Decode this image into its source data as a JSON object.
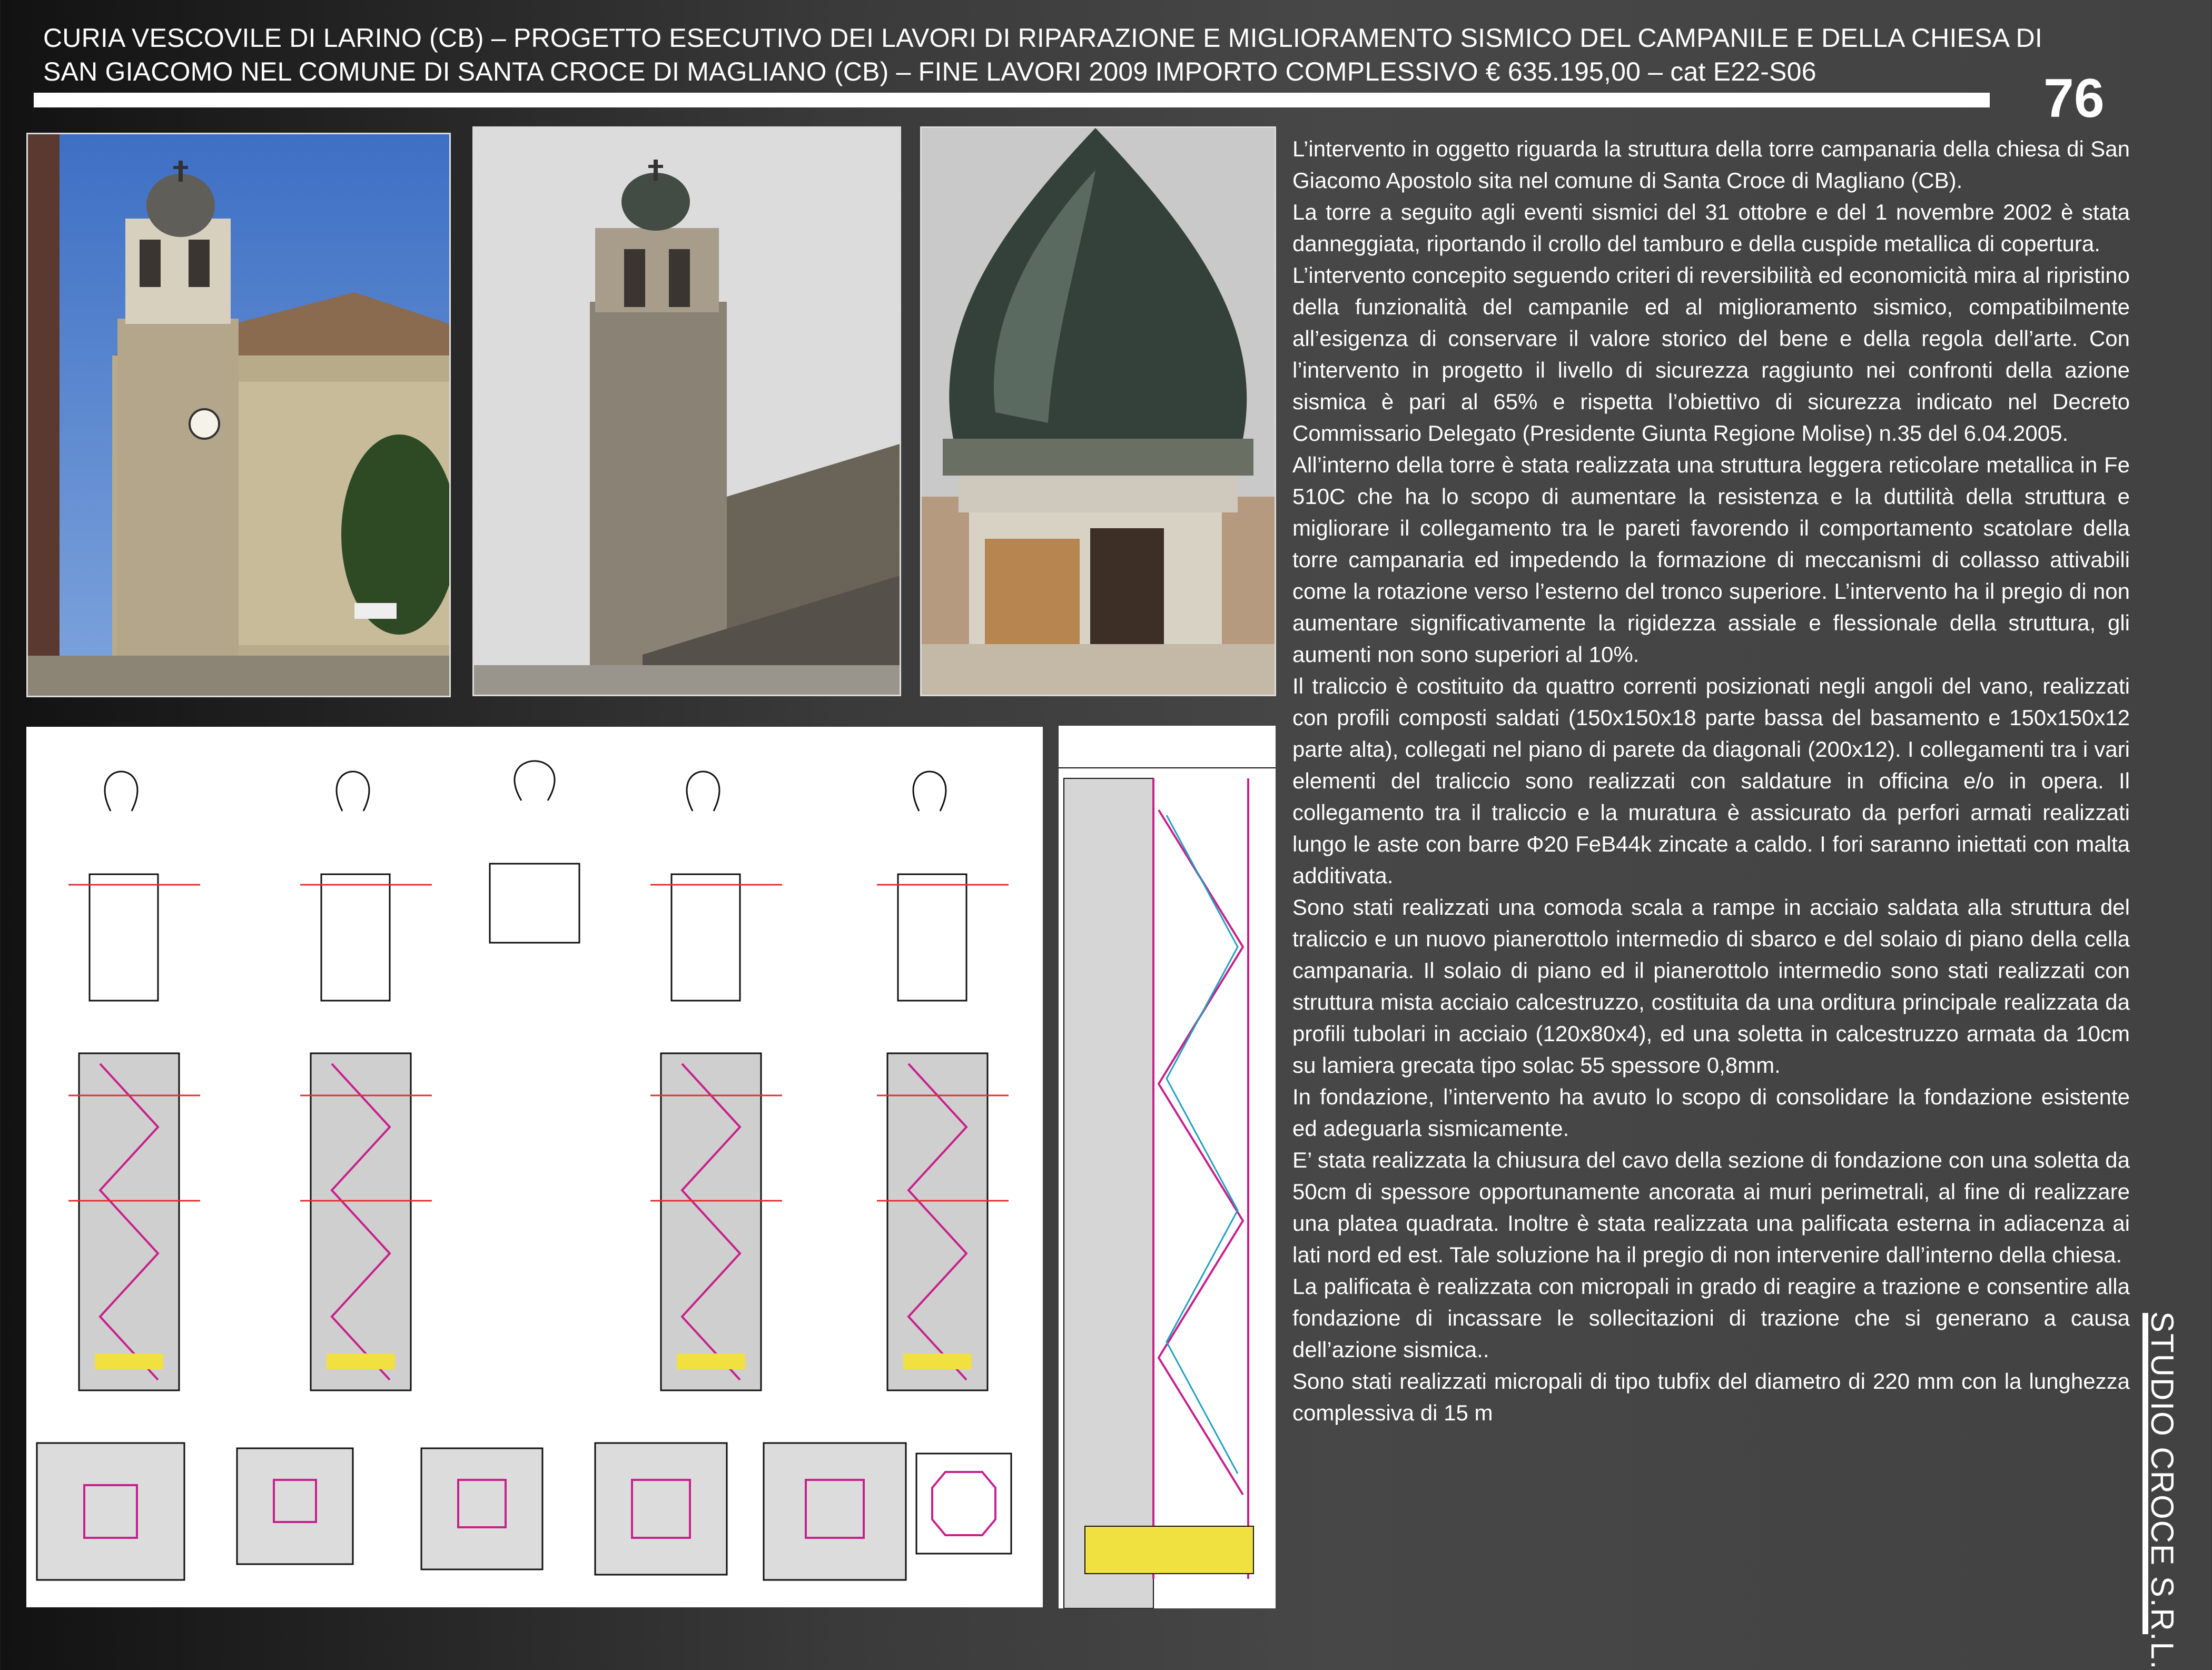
{
  "header": {
    "title_line_1": "CURIA VESCOVILE DI LARINO (CB) – PROGETTO ESECUTIVO DEI LAVORI DI RIPARAZIONE E MIGLIORAMENTO SISMICO DEL CAMPANILE E DELLA CHIESA DI",
    "title_line_2": "SAN GIACOMO NEL COMUNE DI  SANTA CROCE DI MAGLIANO (CB) – FINE LAVORI 2009 IMPORTO COMPLESSIVO € 635.195,00 – cat E22-S06",
    "page_number": "76"
  },
  "footer": {
    "studio_name": "STUDIO CROCE S.R.L."
  },
  "colors": {
    "accent": "#ffffff",
    "sky": "#4b7fd0",
    "stone": "#9a8d78",
    "copper": "#3e4a44"
  },
  "body_paragraphs": [
    "L’intervento in oggetto riguarda la struttura della torre campanaria della chiesa di San Giacomo Apostolo sita nel comune di Santa Croce di Magliano (CB).",
    "La torre a seguito agli eventi sismici del 31 ottobre e del 1 novembre 2002 è stata danneggiata, riportando il crollo del tamburo e della cuspide metallica di copertura.",
    "L’intervento concepito seguendo criteri di reversibilità ed economicità mira al ripristino della funzionalità del campanile ed al miglioramento sismico, compatibilmente all’esigenza di conservare il valore storico del bene e della regola dell’arte. Con l’intervento in progetto il livello di sicurezza raggiunto nei confronti della azione sismica è pari al 65% e rispetta l’obiettivo di sicurezza indicato nel Decreto Commissario Delegato (Presidente Giunta Regione Molise) n.35 del 6.04.2005.",
    "All’interno della torre è stata realizzata una struttura leggera reticolare metallica in Fe 510C che ha lo scopo di aumentare la resistenza e la duttilità della struttura e migliorare il collegamento tra le pareti favorendo il comportamento scatolare della torre campanaria ed impedendo la formazione di meccanismi di collasso attivabili come la rotazione verso l’esterno del tronco superiore. L’intervento ha il pregio di non aumentare significativamente la rigidezza assiale e flessionale della struttura, gli aumenti non sono superiori al 10%.",
    "Il traliccio è costituito da quattro correnti posizionati negli angoli del vano, realizzati con profili composti saldati (150x150x18 parte bassa del basamento e 150x150x12 parte alta), collegati nel piano di parete da diagonali (200x12). I collegamenti tra i vari elementi del traliccio sono realizzati con saldature in officina e/o in opera. Il collegamento tra il traliccio e la muratura è assicurato da perfori armati realizzati lungo le aste con barre Φ20 FeB44k zincate a caldo. I fori saranno iniettati con malta additivata.",
    "Sono stati realizzati una comoda scala a rampe in acciaio saldata alla struttura del traliccio e un nuovo pianerottolo intermedio di sbarco e del solaio di piano della cella campanaria. Il solaio di piano ed il pianerottolo intermedio sono stati realizzati con struttura mista acciaio calcestruzzo, costituita da una orditura principale realizzata da profili tubolari in acciaio (120x80x4), ed una soletta in calcestruzzo armata da 10cm su lamiera grecata tipo solac 55 spessore 0,8mm.",
    "In fondazione, l’intervento ha avuto lo scopo di consolidare la fondazione esistente ed adeguarla sismicamente.",
    "E’ stata realizzata  la chiusura del cavo della sezione di fondazione con una soletta da 50cm di spessore opportunamente ancorata ai muri perimetrali, al fine di realizzare una platea quadrata. Inoltre è stata realizzata una palificata esterna in adiacenza ai lati nord ed est. Tale soluzione ha il pregio di non intervenire dall’interno della chiesa.",
    "La palificata è realizzata con micropali in grado di reagire a trazione e consentire alla fondazione di incassare le sollecitazioni di trazione che si generano a causa dell’azione sismica..",
    "Sono stati realizzati micropali di tipo tubfix del diametro di 220 mm con la lunghezza complessiva di 15 m"
  ],
  "images": {
    "photo_1": "bell-tower-photo-sunny",
    "photo_2": "bell-tower-photo-overcast",
    "photo_3": "damaged-cupola-photo",
    "drawing_sections": "tower-section-drawings",
    "drawing_detail": "stair-section-drawing"
  }
}
